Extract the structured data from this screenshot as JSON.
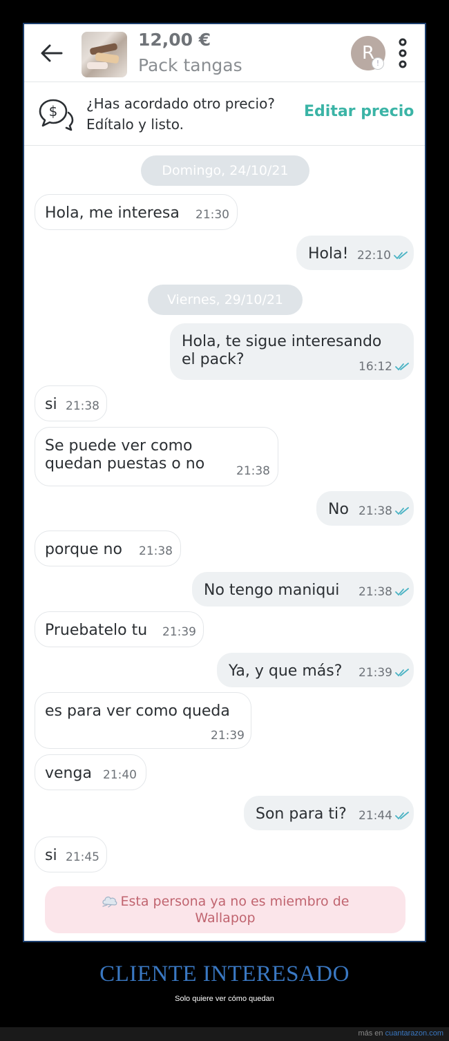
{
  "header": {
    "price": "12,00 €",
    "title": "Pack tangas",
    "avatar_initial": "R",
    "avatar_badge": "!"
  },
  "banner": {
    "line1": "¿Has acordado otro precio?",
    "line2": "Edítalo y listo.",
    "edit_label": "Editar precio"
  },
  "dates": [
    "Domingo, 24/10/21",
    "Viernes, 29/10/21"
  ],
  "messages": [
    {
      "dir": "in",
      "text": "Hola, me interesa",
      "time": "21:30"
    },
    {
      "dir": "out",
      "text": "Hola!",
      "time": "22:10"
    },
    {
      "dir": "out",
      "text": "Hola, te sigue interesando\nel pack?",
      "time": "16:12"
    },
    {
      "dir": "in",
      "text": "si",
      "time": "21:38"
    },
    {
      "dir": "in",
      "text": "Se puede ver como\nquedan puestas o no",
      "time": "21:38"
    },
    {
      "dir": "out",
      "text": "No",
      "time": "21:38"
    },
    {
      "dir": "in",
      "text": "porque no",
      "time": "21:38"
    },
    {
      "dir": "out",
      "text": "No tengo maniqui",
      "time": "21:38"
    },
    {
      "dir": "in",
      "text": "Pruebatelo tu",
      "time": "21:39"
    },
    {
      "dir": "out",
      "text": "Ya, y que más?",
      "time": "21:39"
    },
    {
      "dir": "in",
      "text": "es para ver como queda",
      "time": "21:39"
    },
    {
      "dir": "in",
      "text": "venga",
      "time": "21:40"
    },
    {
      "dir": "out",
      "text": "Son para ti?",
      "time": "21:44"
    },
    {
      "dir": "in",
      "text": "si",
      "time": "21:45"
    }
  ],
  "notice": {
    "line1": "Esta persona ya no es miembro de",
    "line2": "Wallapop"
  },
  "caption": {
    "title": "CLIENTE INTERESADO",
    "subtitle": "Solo quiere ver cómo quedan"
  },
  "footer": {
    "prefix": "más en",
    "site": "cuantarazon.com"
  },
  "colors": {
    "accent": "#3bb4a6",
    "tick": "#4bb3c4",
    "notice_bg": "#fbe5ea",
    "notice_text": "#c0646f"
  }
}
